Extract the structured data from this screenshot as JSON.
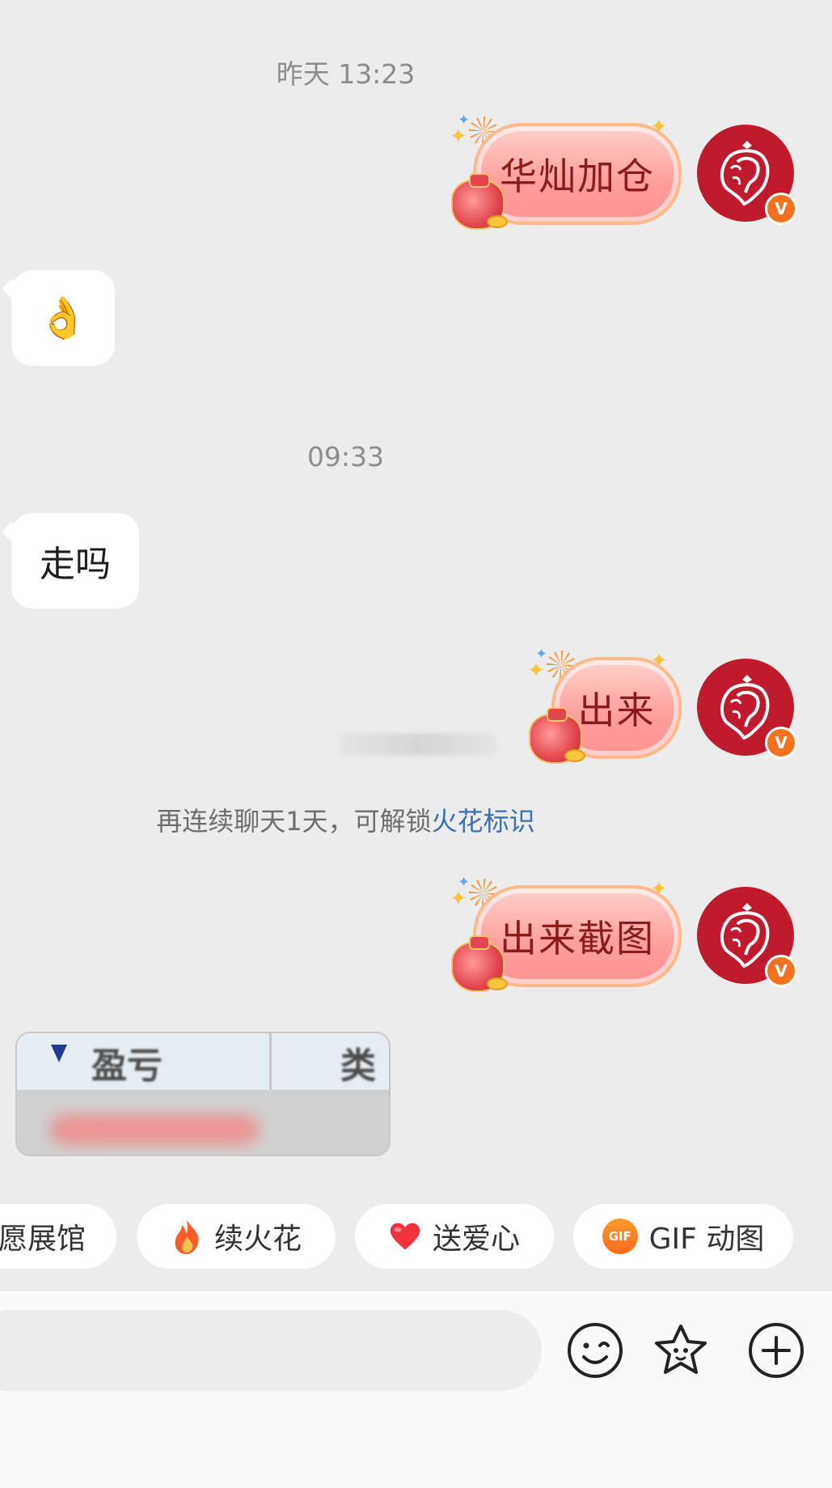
{
  "messages": {
    "ts1": "昨天 13:23",
    "msg1": "华灿加仓",
    "emoji_reply": "👌",
    "ts2": "09:33",
    "msg2": "走吗",
    "msg3": "出来",
    "notice_prefix": "再连续聊天1天，可解锁",
    "notice_link": "火花标识",
    "msg4": "出来截图"
  },
  "image_preview": {
    "text_left": "盈亏",
    "text_right": "类"
  },
  "chips": {
    "chip1": "愿展馆",
    "chip2": "续火花",
    "chip3": "送爱心",
    "chip4": "GIF 动图",
    "gif_icon": "GIF"
  },
  "avatar_badge": "V",
  "colors": {
    "avatar_bg": "#c01a2d",
    "badge": "#f4721f",
    "link": "#3b6fb6"
  },
  "icons": [
    "ok-hand-icon",
    "fire-icon",
    "heart-icon",
    "gif-icon",
    "smile-icon",
    "star-face-icon",
    "plus-circle-icon"
  ]
}
